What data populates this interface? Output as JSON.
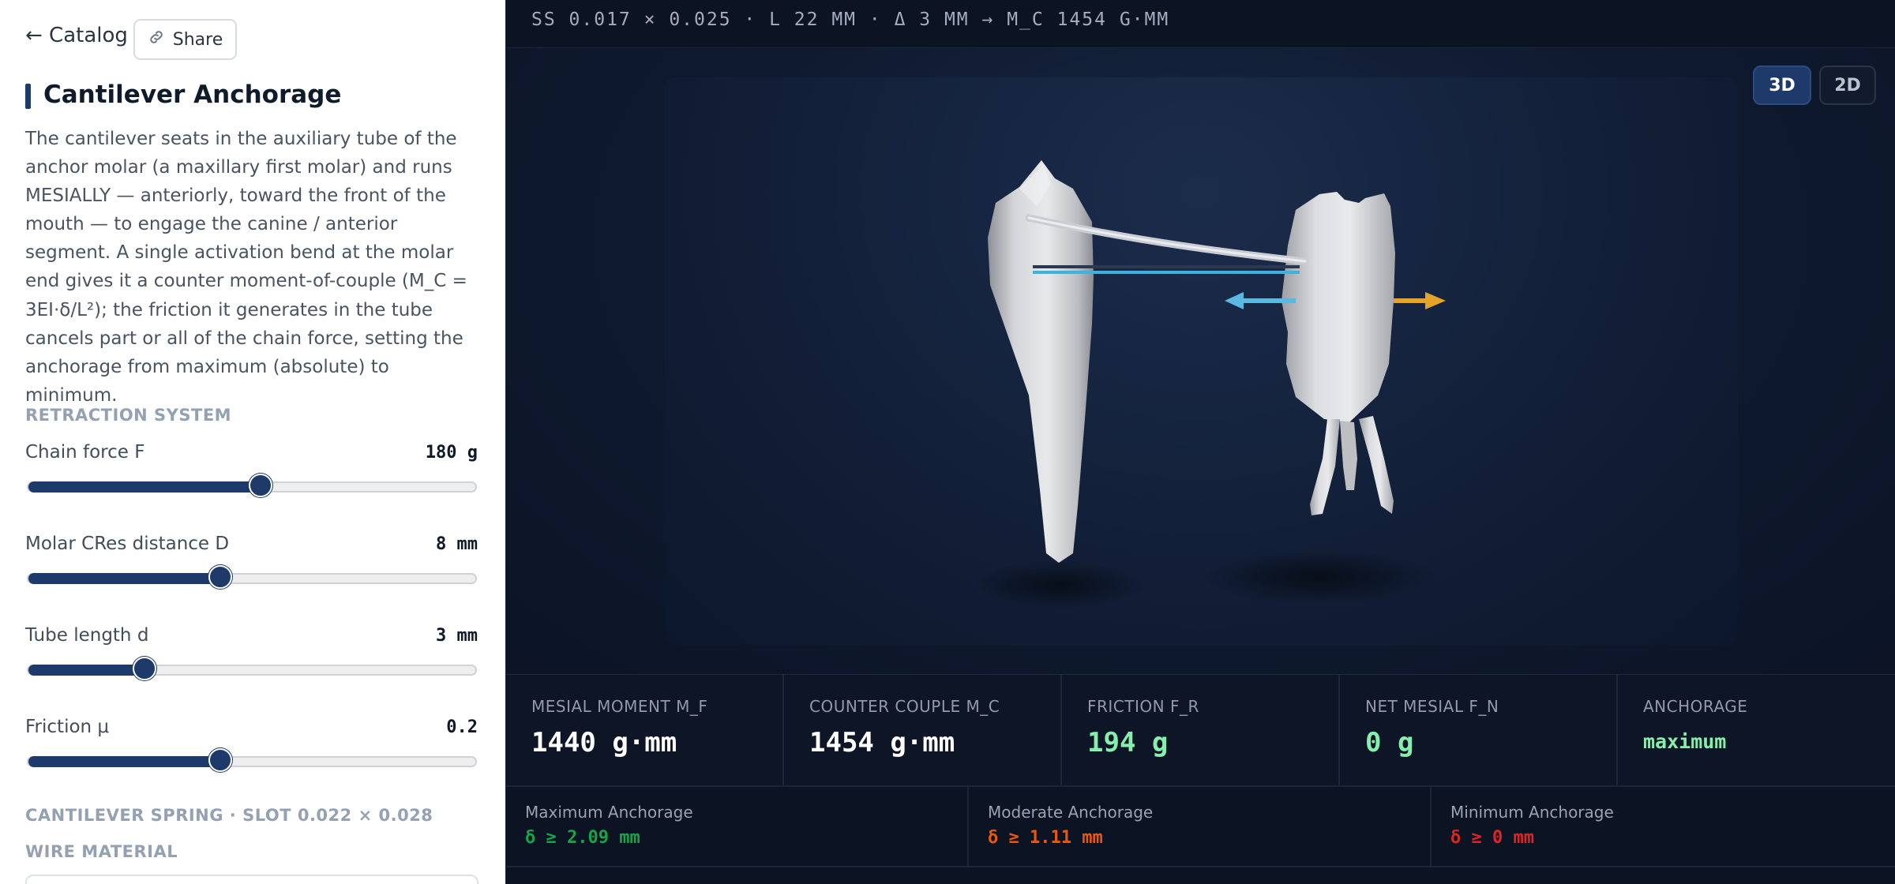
{
  "left": {
    "back_label": "← Catalog",
    "share_label": "Share",
    "title": "Cantilever Anchorage",
    "description": "The cantilever seats in the auxiliary tube of the anchor molar (a maxillary first molar) and runs MESIALLY — anteriorly, toward the front of the mouth — to engage the canine / anterior segment. A single activation bend at the molar end gives it a counter moment-of-couple (M_C = 3EI·δ/L²); the friction it generates in the tube cancels part or all of the chain force, setting the anchorage from maximum (absolute) to minimum.",
    "section_retraction": "RETRACTION SYSTEM",
    "sliders": [
      {
        "label": "Chain force F",
        "value": "180 g",
        "level": 0.52
      },
      {
        "label": "Molar CRes distance D",
        "value": "8 mm",
        "level": 0.43
      },
      {
        "label": "Tube length d",
        "value": "3 mm",
        "level": 0.26
      },
      {
        "label": "Friction μ",
        "value": "0.2",
        "level": 0.43
      }
    ],
    "section_spring": "CANTILEVER SPRING · SLOT 0.022 × 0.028",
    "section_wire": "WIRE MATERIAL"
  },
  "viewer": {
    "formula": "SS 0.017 × 0.025 · L 22 MM · Δ 3 MM → M_C 1454 G·MM",
    "btn_3d": "3D",
    "btn_2d": "2D",
    "active_view": "3D"
  },
  "metrics": [
    {
      "label": "MESIAL MOMENT M_F",
      "value": "1440 g·mm",
      "color": "#ffffff"
    },
    {
      "label": "COUNTER COUPLE M_C",
      "value": "1454 g·mm",
      "color": "#ffffff"
    },
    {
      "label": "FRICTION F_R",
      "value": "194 g",
      "color": "#86efac"
    },
    {
      "label": "NET MESIAL F_N",
      "value": "0 g",
      "color": "#86efac"
    },
    {
      "label": "ANCHORAGE",
      "value": "maximum",
      "color": "#86efac"
    }
  ],
  "scale": [
    {
      "label": "Maximum Anchorage",
      "value": "δ ≥ 2.09 mm",
      "color": "#16a34a"
    },
    {
      "label": "Moderate Anchorage",
      "value": "δ ≥ 1.11 mm",
      "color": "#ea580c"
    },
    {
      "label": "Minimum Anchorage",
      "value": "δ ≥ 0 mm",
      "color": "#dc2626"
    }
  ],
  "colors": {
    "accent": "#1e3a6b",
    "force_arrow": "#e5a32a",
    "friction_arrow": "#5bb8e0",
    "wire_blue": "#3bb3e0"
  },
  "icons": {
    "share": "link-icon"
  }
}
